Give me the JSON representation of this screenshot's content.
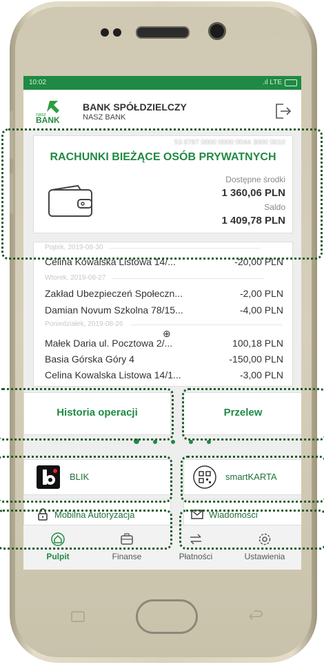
{
  "status": {
    "time": "10:02",
    "network": "LTE"
  },
  "header": {
    "bank_name": "BANK SPÓŁDZIELCZY",
    "bank_sub": "NASZ BANK",
    "logo_small": "nasz",
    "logo_big": "BANK"
  },
  "account": {
    "number": "53 8787 0000 0000 0044 3000 0010",
    "title": "RACHUNKI BIEŻĄCE OSÓB PRYWATNYCH",
    "available_label": "Dostępne środki",
    "available_value": "1 360,06 PLN",
    "balance_label": "Saldo",
    "balance_value": "1 409,78 PLN"
  },
  "transactions": {
    "dates": [
      "Piątek, 2019-08-30",
      "Wtorek, 2019-08-27",
      "Poniedziałek, 2019-08-26"
    ],
    "rows": [
      {
        "desc": "Celina Kowalska Listowa 14/...",
        "amount": "-20,00 PLN"
      },
      {
        "desc": "Zakład Ubezpieczeń Społeczn...",
        "amount": "-2,00 PLN"
      },
      {
        "desc": "Damian Novum Szkolna 78/15...",
        "amount": "-4,00 PLN"
      },
      {
        "desc": "Małek Daria  ul. Pocztowa 2/...",
        "amount": "100,18 PLN"
      },
      {
        "desc": "Basia Górska Góry 4",
        "amount": "-150,00 PLN"
      },
      {
        "desc": "Celina Kowalska Listowa 14/1...",
        "amount": "-3,00 PLN"
      }
    ]
  },
  "actions": {
    "history": "Historia operacji",
    "transfer": "Przelew"
  },
  "tiles": {
    "blik": "BLIK",
    "smartkarta": "smartKARTA",
    "mobile_auth": "Mobilna Autoryzacja",
    "messages": "Wiadomości"
  },
  "nav": {
    "items": [
      {
        "label": "Pulpit",
        "icon": "home-icon"
      },
      {
        "label": "Finanse",
        "icon": "wallet-icon"
      },
      {
        "label": "Płatności",
        "icon": "transfer-arrows-icon"
      },
      {
        "label": "Ustawienia",
        "icon": "gear-icon"
      }
    ]
  },
  "colors": {
    "brand_green": "#1f8a43",
    "highlight_dotted": "#1e5c28"
  }
}
